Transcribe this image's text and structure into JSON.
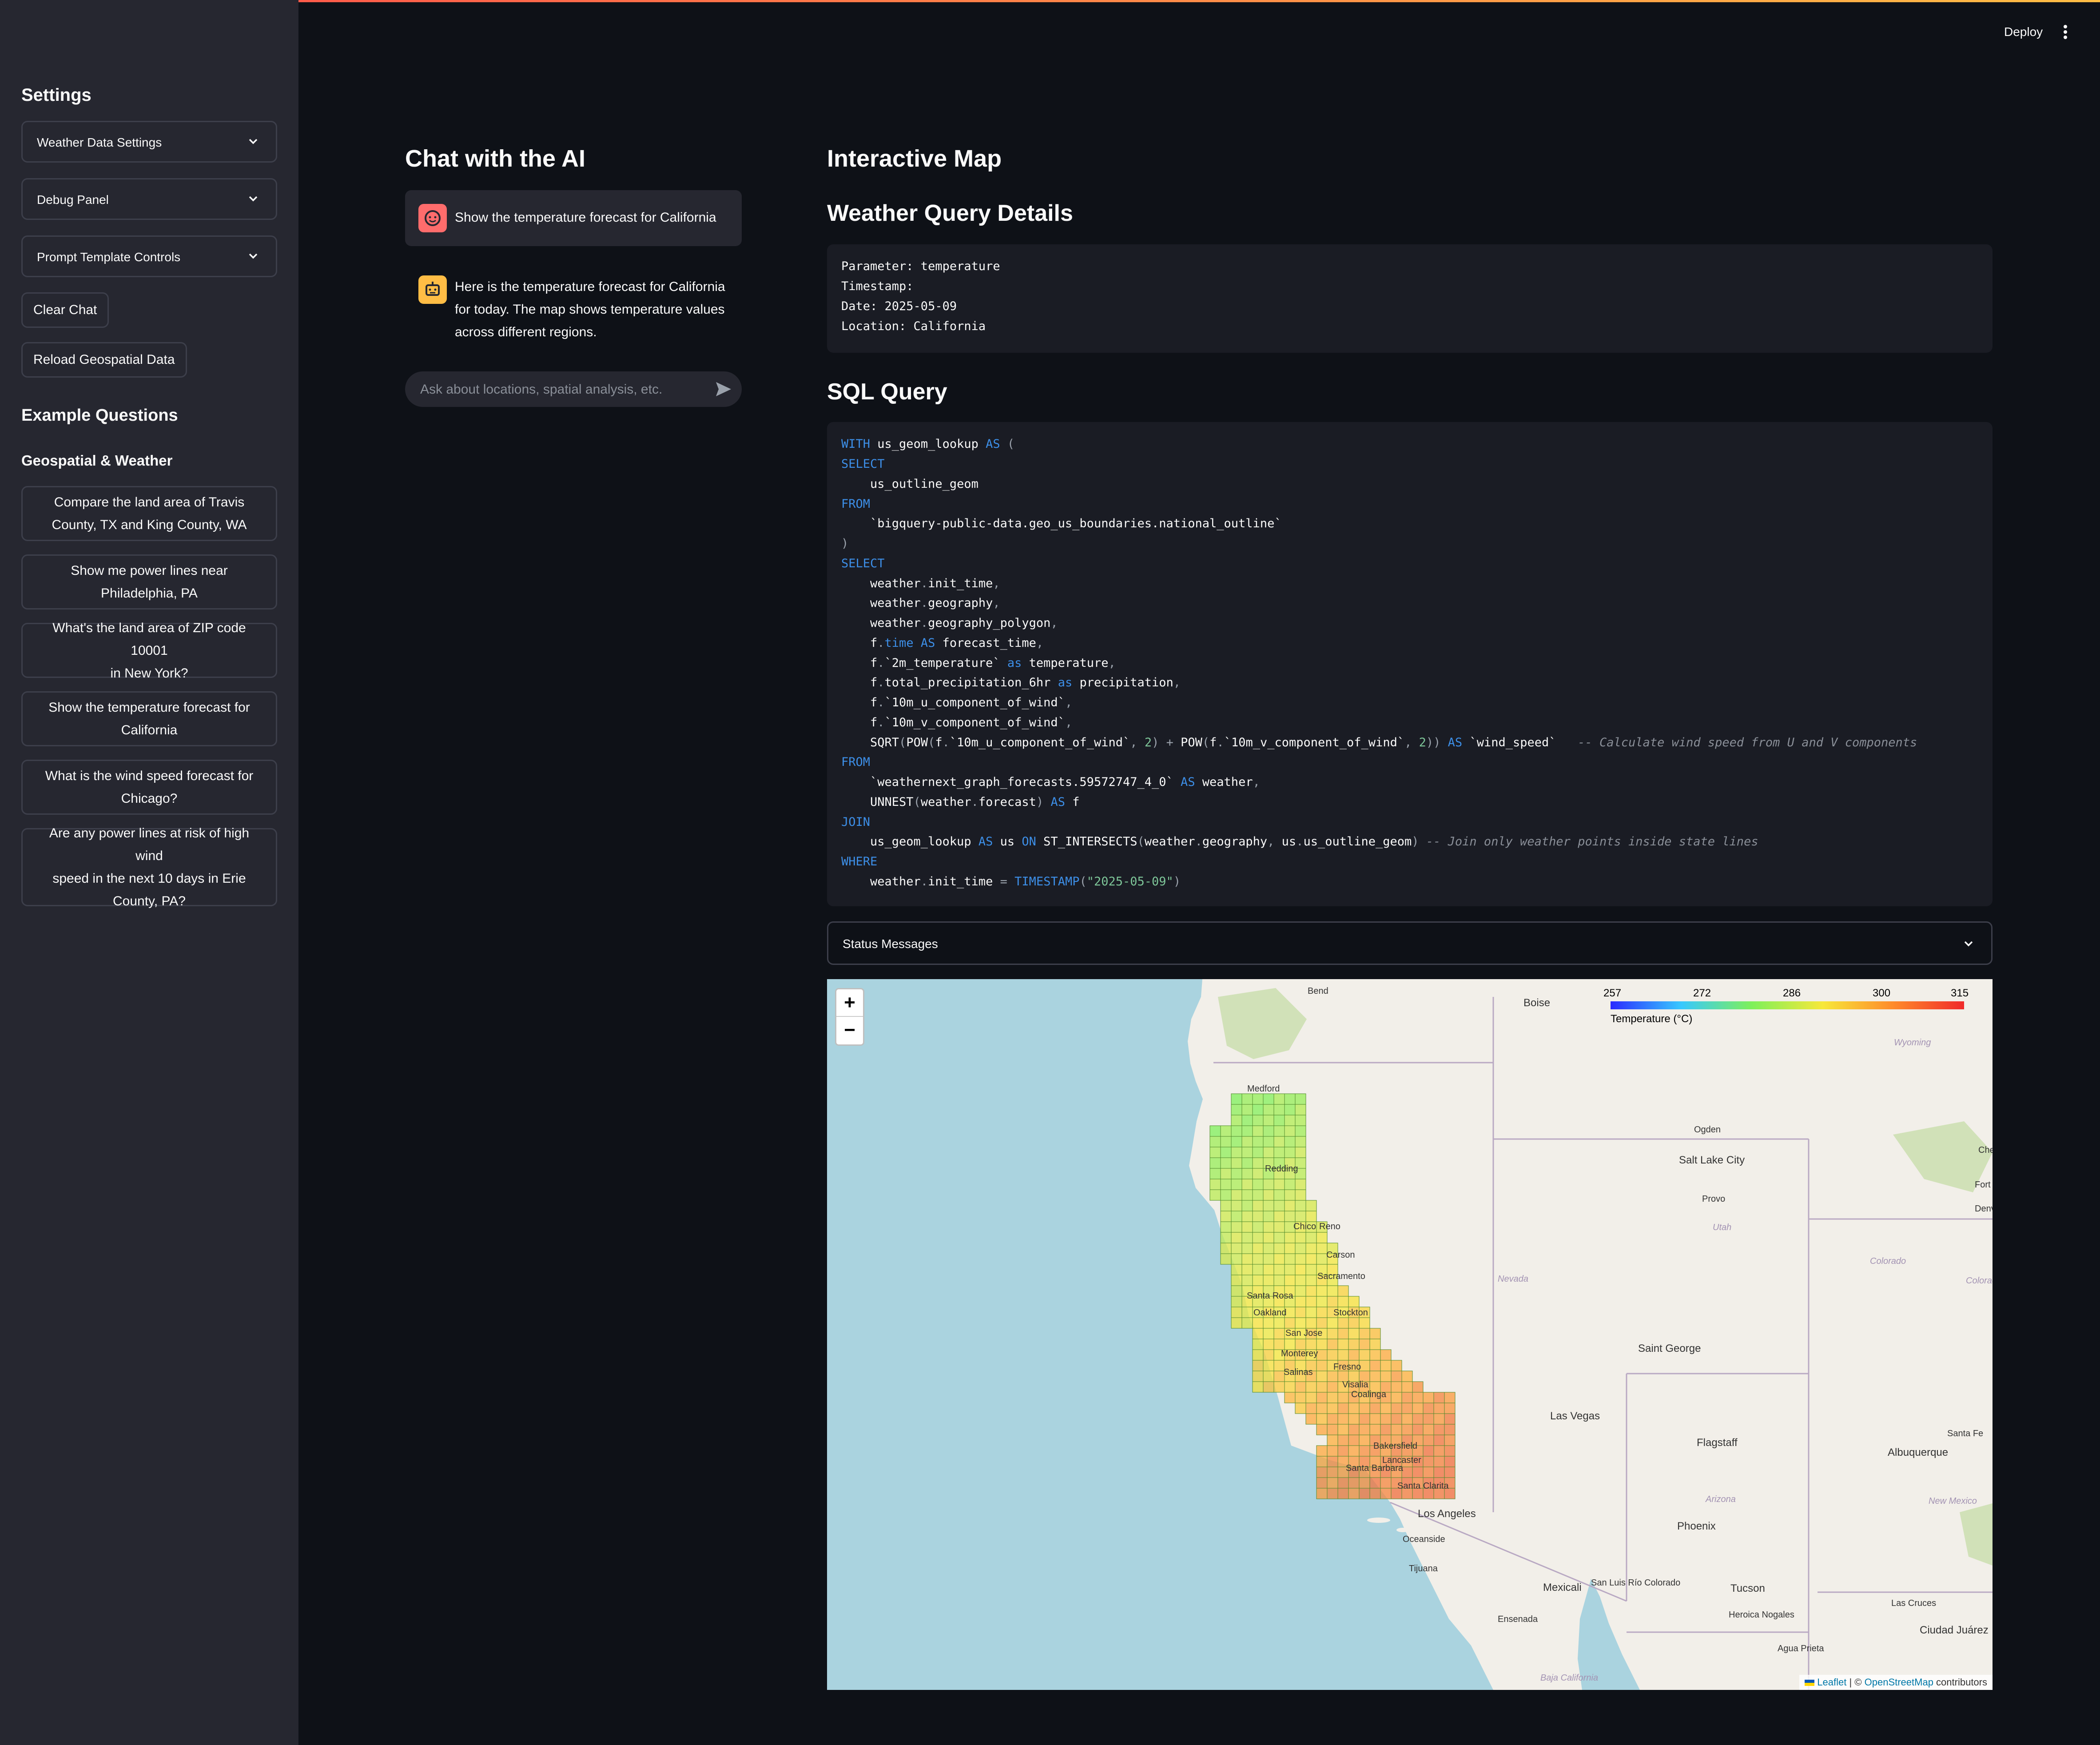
{
  "app": {
    "deploy_label": "Deploy"
  },
  "sidebar": {
    "settings_title": "Settings",
    "expanders": [
      {
        "label": "Weather Data Settings"
      },
      {
        "label": "Debug Panel"
      },
      {
        "label": "Prompt Template Controls"
      }
    ],
    "clear_chat_label": "Clear Chat",
    "reload_label": "Reload Geospatial Data",
    "examples_title": "Example Questions",
    "examples_subtitle": "Geospatial & Weather",
    "questions": [
      {
        "lines": [
          "Compare the land area of Travis",
          "County, TX and King County, WA"
        ]
      },
      {
        "lines": [
          "Show me power lines near",
          "Philadelphia, PA"
        ]
      },
      {
        "lines": [
          "What's the land area of ZIP code 10001",
          "in New York?"
        ]
      },
      {
        "lines": [
          "Show the temperature forecast for",
          "California"
        ]
      },
      {
        "lines": [
          "What is the wind speed forecast for",
          "Chicago?"
        ]
      },
      {
        "lines": [
          "Are any power lines at risk of high wind",
          "speed in the next 10 days in Erie",
          "County, PA?"
        ]
      }
    ]
  },
  "chat": {
    "title": "Chat with the AI",
    "user_message": "Show the temperature forecast for California",
    "assistant_lines": [
      "Here is the temperature forecast for California",
      "for today. The map shows temperature values",
      "across different regions."
    ],
    "input_placeholder": "Ask about locations, spatial analysis, etc."
  },
  "main": {
    "map_title": "Interactive Map",
    "details_title": "Weather Query Details",
    "details_lines": [
      "Parameter: temperature",
      "Timestamp:",
      "Date: 2025-05-09",
      "Location: California"
    ],
    "sql_title": "SQL Query",
    "status_label": "Status Messages"
  },
  "map": {
    "legend": {
      "ticks": [
        "257",
        "272",
        "286",
        "300",
        "315"
      ],
      "caption": "Temperature (°C)",
      "colors": [
        "#2b2bff",
        "#38c8ff",
        "#7ef05a",
        "#f7e83a",
        "#ff8a2a",
        "#f02a2a"
      ]
    },
    "zoom_in": "+",
    "zoom_out": "−",
    "attribution": {
      "leaflet": "Leaflet",
      "sep": " | © ",
      "osm": "OpenStreetMap",
      "suffix": " contributors"
    },
    "places": [
      "Boise",
      "Bend",
      "Medford",
      "Redding",
      "Chico",
      "Reno",
      "Carson",
      "Sacramento",
      "Santa Rosa",
      "Oakland",
      "Stockton",
      "San Jose",
      "Salinas",
      "Fresno",
      "Visalia",
      "Bakersfield",
      "Lancaster",
      "Santa Clarita",
      "Los Angeles",
      "Oceanside",
      "Tijuana",
      "Mexicali",
      "San Luis Río Colorado",
      "Ensenada",
      "Baja California",
      "Las Vegas",
      "Saint George",
      "Flagstaff",
      "Phoenix",
      "Tucson",
      "Heroica Nogales",
      "Agua Prieta",
      "Las Cruces",
      "Ciudad Juárez",
      "Albuquerque",
      "Santa Fe",
      "Salt Lake City",
      "Ogden",
      "Provo",
      "Utah",
      "Nevada",
      "Arizona",
      "New Mexico",
      "Colorado",
      "Wyoming",
      "Denv",
      "Fort Col",
      "Chey",
      "Colorado",
      "Santa Barbara",
      "Monterey",
      "Coalinga"
    ]
  }
}
